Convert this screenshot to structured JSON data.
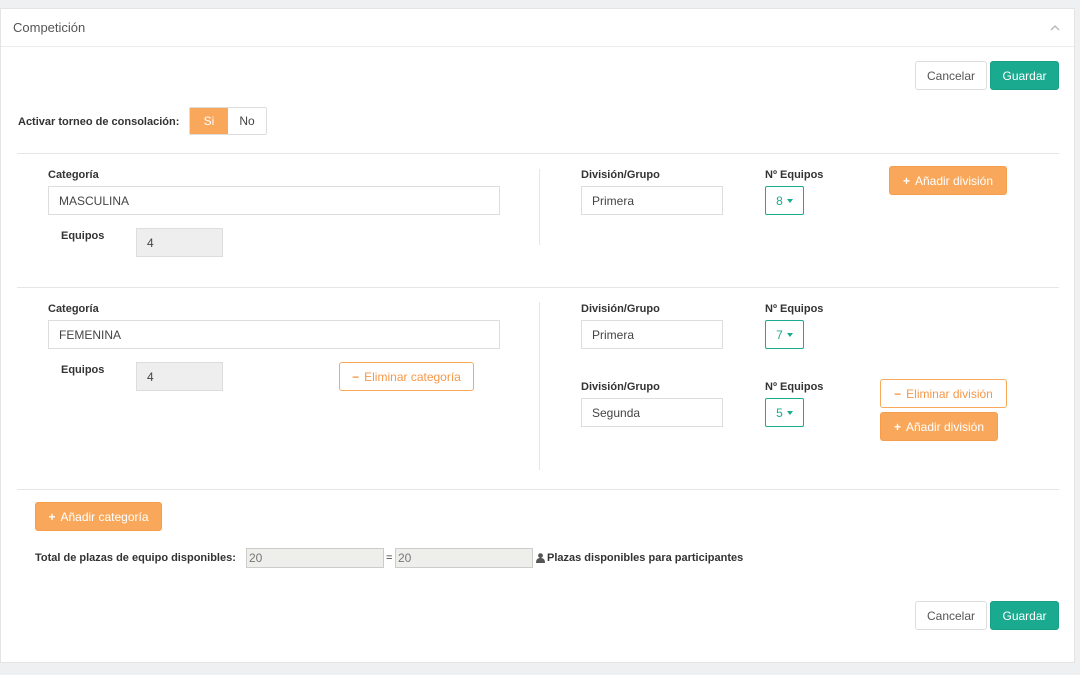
{
  "panel": {
    "title": "Competición"
  },
  "toolbar": {
    "cancel_label": "Cancelar",
    "save_label": "Guardar"
  },
  "consolation": {
    "label": "Activar torneo de consolación:",
    "yes": "Si",
    "no": "No"
  },
  "labels": {
    "categoria": "Categoría",
    "equipos": "Equipos",
    "division": "División/Grupo",
    "n_equipos": "Nº Equipos",
    "add_division": "Añadir división",
    "remove_division": "Eliminar división",
    "remove_category": "Eliminar categoría",
    "add_category": "Añadir categoría"
  },
  "categories": [
    {
      "name": "MASCULINA",
      "teams": "4",
      "divisions": [
        {
          "name": "Primera",
          "teams": "8"
        }
      ]
    },
    {
      "name": "FEMENINA",
      "teams": "4",
      "divisions": [
        {
          "name": "Primera",
          "teams": "7"
        },
        {
          "name": "Segunda",
          "teams": "5"
        }
      ]
    }
  ],
  "totals": {
    "label": "Total de plazas de equipo disponibles:",
    "value1": "20",
    "eq": "=",
    "value2": "20",
    "suffix": "Plazas disponibles para participantes"
  },
  "colors": {
    "accent_green": "#1aaa8f",
    "accent_orange": "#f9a85b"
  }
}
